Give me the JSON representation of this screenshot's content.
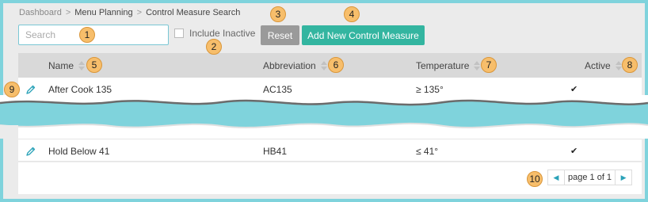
{
  "breadcrumb": {
    "items": [
      "Dashboard",
      "Menu Planning",
      "Control Measure Search"
    ],
    "separator": ">"
  },
  "search": {
    "placeholder": "Search",
    "value": ""
  },
  "include_inactive": {
    "label": "Include Inactive",
    "checked": false
  },
  "buttons": {
    "reset": "Reset",
    "add": "Add New Control Measure"
  },
  "columns": [
    {
      "label": "Name"
    },
    {
      "label": "Abbreviation"
    },
    {
      "label": "Temperature"
    },
    {
      "label": "Active"
    }
  ],
  "rows": [
    {
      "name": "After Cook 135",
      "abbreviation": "AC135",
      "temperature": "≥ 135°",
      "active": "✔"
    },
    {
      "name": "Hold Below 41",
      "abbreviation": "HB41",
      "temperature": "≤ 41°",
      "active": "✔"
    }
  ],
  "pagination": {
    "text": "page 1 of 1",
    "prev_icon": "chevron-left-icon",
    "next_icon": "chevron-right-icon"
  },
  "callouts": [
    "1",
    "2",
    "3",
    "4",
    "5",
    "6",
    "7",
    "8",
    "9",
    "10"
  ],
  "colors": {
    "page_border": "#7fd3dc",
    "accent": "#33b5a0",
    "reset": "#9a9a9a",
    "callout": "#f7be6b",
    "link": "#2aa2b8"
  }
}
